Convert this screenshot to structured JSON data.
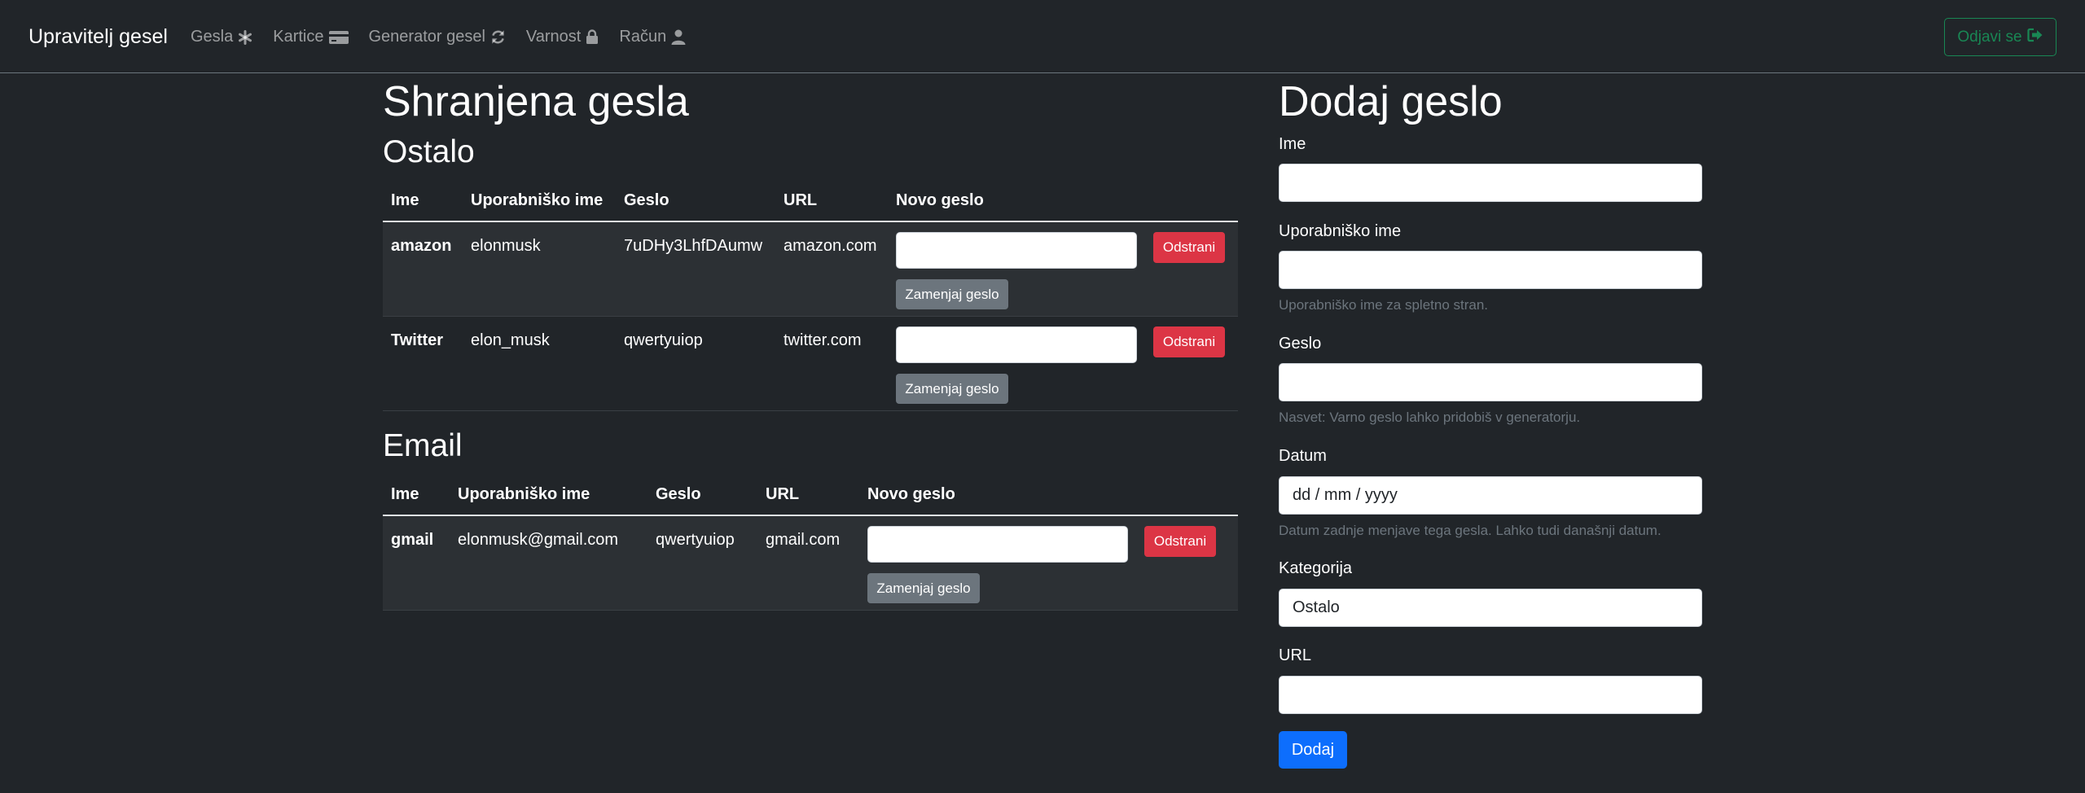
{
  "nav": {
    "brand": "Upravitelj gesel",
    "links": [
      {
        "label": "Gesla",
        "icon": "asterisk-icon"
      },
      {
        "label": "Kartice",
        "icon": "credit-card-icon"
      },
      {
        "label": "Generator gesel",
        "icon": "refresh-icon"
      },
      {
        "label": "Varnost",
        "icon": "lock-icon"
      },
      {
        "label": "Račun",
        "icon": "user-icon"
      }
    ],
    "logout": "Odjavi se"
  },
  "saved": {
    "title": "Shranjena gesla",
    "headers": {
      "name": "Ime",
      "user": "Uporabniško ime",
      "pw": "Geslo",
      "url": "URL",
      "new_pw": "Novo geslo"
    },
    "delete_label": "Odstrani",
    "replace_label": "Zamenjaj geslo",
    "categories": [
      {
        "name": "Ostalo",
        "rows": [
          {
            "name": "amazon",
            "user": "elonmusk",
            "pw": "7uDHy3LhfDAumw",
            "url": "amazon.com"
          },
          {
            "name": "Twitter",
            "user": "elon_musk",
            "pw": "qwertyuiop",
            "url": "twitter.com"
          }
        ]
      },
      {
        "name": "Email",
        "rows": [
          {
            "name": "gmail",
            "user": "elonmusk@gmail.com",
            "pw": "qwertyuiop",
            "url": "gmail.com"
          }
        ]
      }
    ]
  },
  "form": {
    "title": "Dodaj geslo",
    "name_label": "Ime",
    "user_label": "Uporabniško ime",
    "user_hint": "Uporabniško ime za spletno stran.",
    "pw_label": "Geslo",
    "pw_hint": "Nasvet: Varno geslo lahko pridobiš v generatorju.",
    "date_label": "Datum",
    "date_placeholder": "dd / mm / yyyy",
    "date_hint": "Datum zadnje menjave tega gesla. Lahko tudi današnji datum.",
    "category_label": "Kategorija",
    "category_value": "Ostalo",
    "url_label": "URL",
    "submit": "Dodaj"
  },
  "colors": {
    "background": "#212529",
    "danger": "#dc3545",
    "secondary": "#6c757d",
    "primary": "#0d6efd",
    "success": "#198754"
  }
}
